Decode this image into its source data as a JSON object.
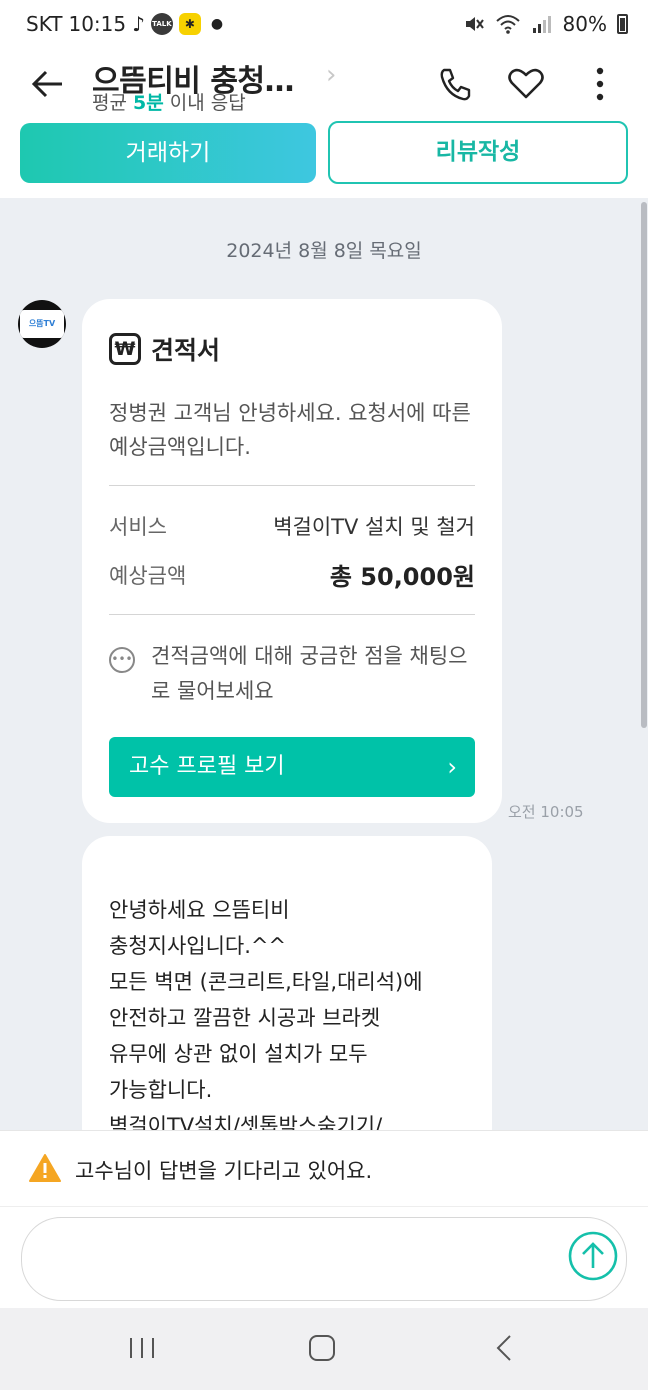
{
  "status_bar": {
    "carrier": "SKT",
    "time": "10:15",
    "battery": "80%"
  },
  "header": {
    "title": "으뜸티비 충청…",
    "response_prefix": "평균 ",
    "response_value": "5분",
    "response_suffix": " 이내 응답",
    "trade_button": "거래하기",
    "review_button": "리뷰작성"
  },
  "chat": {
    "date": "2024년 8월 8일 목요일",
    "avatar_text": "으뜸TV",
    "quote": {
      "icon": "₩",
      "title": "견적서",
      "greeting": "정병권 고객님 안녕하세요. 요청서에 따른 예상금액입니다.",
      "service_label": "서비스",
      "service_value": "벽걸이TV 설치 및 철거",
      "price_label": "예상금액",
      "price_value": "총 50,000원",
      "hint": "견적금액에 대해 궁금한 점을 채팅으로 물어보세요",
      "profile_button": "고수 프로필 보기",
      "time": "오전 10:05"
    },
    "message_lines": [
      "안녕하세요 으뜸티비",
      "충청지사입니다.^^",
      "모든 벽면 (콘크리트,타일,대리석)에",
      "안전하고 깔끔한 시공과 브라켓",
      "유무에 상관 없이 설치가 모두",
      "가능합니다.",
      "벽걸이TV설치/셋톱박스숨기기/"
    ]
  },
  "waiting_banner": "고수님이 답변을 기다리고 있어요.",
  "input": {
    "placeholder": ""
  },
  "colors": {
    "accent": "#00c2a8",
    "chat_bg": "#eceff3",
    "warning": "#f5a623"
  }
}
